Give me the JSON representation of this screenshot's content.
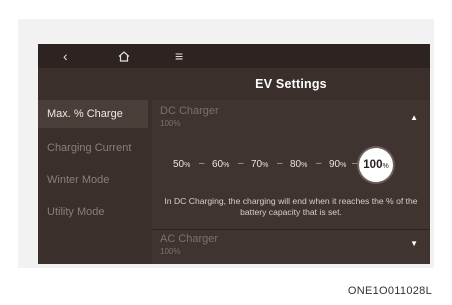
{
  "topbar": {
    "back_glyph": "‹",
    "home_glyph": "⌂",
    "menu_glyph": "≡"
  },
  "title": "EV Settings",
  "sidebar": {
    "items": [
      {
        "label": "Max. % Charge"
      },
      {
        "label": "Charging Current"
      },
      {
        "label": "Winter Mode"
      },
      {
        "label": "Utility Mode"
      }
    ]
  },
  "dc_charger": {
    "label": "DC Charger",
    "value": "100%",
    "caret": "▲",
    "steps": [
      {
        "num": "50",
        "unit": "%"
      },
      {
        "num": "60",
        "unit": "%"
      },
      {
        "num": "70",
        "unit": "%"
      },
      {
        "num": "80",
        "unit": "%"
      },
      {
        "num": "90",
        "unit": "%"
      }
    ],
    "selected_step": {
      "num": "100",
      "unit": "%"
    },
    "note": "In DC Charging, the charging will end when it reaches the % of the battery capacity that is set."
  },
  "ac_charger": {
    "label": "AC Charger",
    "value": "100%",
    "caret": "▼"
  },
  "caption": "ONE1O011028L",
  "colors": {
    "screen_bg": "#3a2f2a",
    "active_item_bg": "#4a3e39",
    "selected_step_bg": "#ffffff"
  }
}
